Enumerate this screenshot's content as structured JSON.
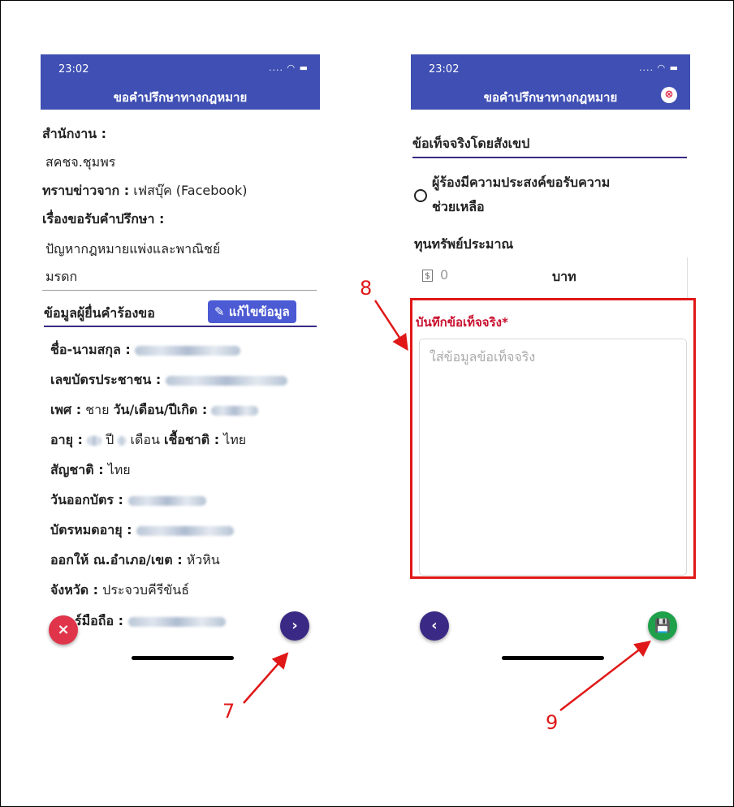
{
  "status_bar": {
    "time": "23:02",
    "icons": "....  ◠ ▬"
  },
  "left_screen": {
    "nav_title": "ขอคำปรึกษาทางกฎหมาย",
    "office_label": "สำนักงาน :",
    "office_value": "สคชจ.ชุมพร",
    "source_label": "ทราบข่าวจาก :",
    "source_value": "เฟสบุ๊ค (Facebook)",
    "topic_label": "เรื่องขอรับคำปรึกษา :",
    "topic_value_line1": "ปัญหากฎหมายแพ่งและพาณิชย์",
    "topic_value_line2": "มรดก",
    "applicant_header": "ข้อมูลผู้ยื่นคำร้องขอ",
    "edit_button_label": "แก้ไขข้อมูล",
    "name_label": "ชื่อ-นามสกุล :",
    "id_label": "เลขบัตรประชาชน :",
    "gender_label": "เพศ :",
    "gender_value": "ชาย",
    "dob_label": "วัน/เดือน/ปีเกิด :",
    "age_label": "อายุ :",
    "age_year_unit": "ปี",
    "age_month_unit": "เดือน",
    "ethnicity_label": "เชื้อชาติ :",
    "ethnicity_value": "ไทย",
    "nationality_label": "สัญชาติ :",
    "nationality_value": "ไทย",
    "issue_date_label": "วันออกบัตร :",
    "expiry_label": "บัตรหมดอายุ :",
    "issued_by_label": "ออกให้ ณ.อำเภอ/เขต :",
    "issued_by_value": "หัวหิน",
    "province_label": "จังหวัด :",
    "province_value": "ประจวบคีรีขันธ์",
    "mobile_label": "ร์มือถือ :",
    "cancel_icon": "×",
    "next_icon": "›"
  },
  "right_screen": {
    "nav_title": "ขอคำปรึกษาทางกฎหมาย",
    "close_icon": "⊗",
    "summary_header": "ข้อเท็จจริงโดยสังเขป",
    "assistance_option_line1": "ผู้ร้องมีความประสงค์ขอรับความ",
    "assistance_option_line2": "ช่วยเหลือ",
    "capital_label": "ทุนทรัพย์ประมาณ",
    "money_icon": "$",
    "capital_value": "0",
    "capital_unit": "บาท",
    "facts_label": "บันทึกข้อเท็จจริง*",
    "facts_placeholder": "ใส่ข้อมูลข้อเท็จจริง",
    "back_icon": "‹",
    "save_icon": "💾"
  },
  "callouts": [
    "7",
    "8",
    "9"
  ],
  "colors": {
    "header_blue": "#3f4fb3",
    "fab_purple": "#3b2a85",
    "fab_red": "#e0344a",
    "fab_green": "#1fa04a",
    "annotation_red": "#e01818",
    "required_red": "#c8102e"
  }
}
